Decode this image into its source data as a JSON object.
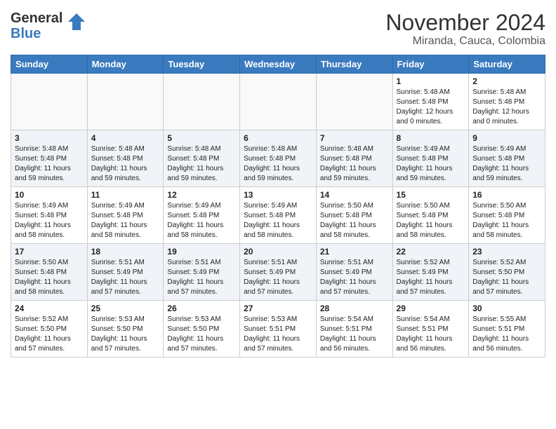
{
  "logo": {
    "part1": "General",
    "part2": "Blue"
  },
  "title": "November 2024",
  "subtitle": "Miranda, Cauca, Colombia",
  "weekdays": [
    "Sunday",
    "Monday",
    "Tuesday",
    "Wednesday",
    "Thursday",
    "Friday",
    "Saturday"
  ],
  "weeks": [
    {
      "alt": false,
      "days": [
        {
          "num": "",
          "sunrise": "",
          "sunset": "",
          "daylight": "",
          "empty": true
        },
        {
          "num": "",
          "sunrise": "",
          "sunset": "",
          "daylight": "",
          "empty": true
        },
        {
          "num": "",
          "sunrise": "",
          "sunset": "",
          "daylight": "",
          "empty": true
        },
        {
          "num": "",
          "sunrise": "",
          "sunset": "",
          "daylight": "",
          "empty": true
        },
        {
          "num": "",
          "sunrise": "",
          "sunset": "",
          "daylight": "",
          "empty": true
        },
        {
          "num": "1",
          "sunrise": "Sunrise: 5:48 AM",
          "sunset": "Sunset: 5:48 PM",
          "daylight": "Daylight: 12 hours and 0 minutes.",
          "empty": false
        },
        {
          "num": "2",
          "sunrise": "Sunrise: 5:48 AM",
          "sunset": "Sunset: 5:48 PM",
          "daylight": "Daylight: 12 hours and 0 minutes.",
          "empty": false
        }
      ]
    },
    {
      "alt": true,
      "days": [
        {
          "num": "3",
          "sunrise": "Sunrise: 5:48 AM",
          "sunset": "Sunset: 5:48 PM",
          "daylight": "Daylight: 11 hours and 59 minutes.",
          "empty": false
        },
        {
          "num": "4",
          "sunrise": "Sunrise: 5:48 AM",
          "sunset": "Sunset: 5:48 PM",
          "daylight": "Daylight: 11 hours and 59 minutes.",
          "empty": false
        },
        {
          "num": "5",
          "sunrise": "Sunrise: 5:48 AM",
          "sunset": "Sunset: 5:48 PM",
          "daylight": "Daylight: 11 hours and 59 minutes.",
          "empty": false
        },
        {
          "num": "6",
          "sunrise": "Sunrise: 5:48 AM",
          "sunset": "Sunset: 5:48 PM",
          "daylight": "Daylight: 11 hours and 59 minutes.",
          "empty": false
        },
        {
          "num": "7",
          "sunrise": "Sunrise: 5:48 AM",
          "sunset": "Sunset: 5:48 PM",
          "daylight": "Daylight: 11 hours and 59 minutes.",
          "empty": false
        },
        {
          "num": "8",
          "sunrise": "Sunrise: 5:49 AM",
          "sunset": "Sunset: 5:48 PM",
          "daylight": "Daylight: 11 hours and 59 minutes.",
          "empty": false
        },
        {
          "num": "9",
          "sunrise": "Sunrise: 5:49 AM",
          "sunset": "Sunset: 5:48 PM",
          "daylight": "Daylight: 11 hours and 59 minutes.",
          "empty": false
        }
      ]
    },
    {
      "alt": false,
      "days": [
        {
          "num": "10",
          "sunrise": "Sunrise: 5:49 AM",
          "sunset": "Sunset: 5:48 PM",
          "daylight": "Daylight: 11 hours and 58 minutes.",
          "empty": false
        },
        {
          "num": "11",
          "sunrise": "Sunrise: 5:49 AM",
          "sunset": "Sunset: 5:48 PM",
          "daylight": "Daylight: 11 hours and 58 minutes.",
          "empty": false
        },
        {
          "num": "12",
          "sunrise": "Sunrise: 5:49 AM",
          "sunset": "Sunset: 5:48 PM",
          "daylight": "Daylight: 11 hours and 58 minutes.",
          "empty": false
        },
        {
          "num": "13",
          "sunrise": "Sunrise: 5:49 AM",
          "sunset": "Sunset: 5:48 PM",
          "daylight": "Daylight: 11 hours and 58 minutes.",
          "empty": false
        },
        {
          "num": "14",
          "sunrise": "Sunrise: 5:50 AM",
          "sunset": "Sunset: 5:48 PM",
          "daylight": "Daylight: 11 hours and 58 minutes.",
          "empty": false
        },
        {
          "num": "15",
          "sunrise": "Sunrise: 5:50 AM",
          "sunset": "Sunset: 5:48 PM",
          "daylight": "Daylight: 11 hours and 58 minutes.",
          "empty": false
        },
        {
          "num": "16",
          "sunrise": "Sunrise: 5:50 AM",
          "sunset": "Sunset: 5:48 PM",
          "daylight": "Daylight: 11 hours and 58 minutes.",
          "empty": false
        }
      ]
    },
    {
      "alt": true,
      "days": [
        {
          "num": "17",
          "sunrise": "Sunrise: 5:50 AM",
          "sunset": "Sunset: 5:48 PM",
          "daylight": "Daylight: 11 hours and 58 minutes.",
          "empty": false
        },
        {
          "num": "18",
          "sunrise": "Sunrise: 5:51 AM",
          "sunset": "Sunset: 5:49 PM",
          "daylight": "Daylight: 11 hours and 57 minutes.",
          "empty": false
        },
        {
          "num": "19",
          "sunrise": "Sunrise: 5:51 AM",
          "sunset": "Sunset: 5:49 PM",
          "daylight": "Daylight: 11 hours and 57 minutes.",
          "empty": false
        },
        {
          "num": "20",
          "sunrise": "Sunrise: 5:51 AM",
          "sunset": "Sunset: 5:49 PM",
          "daylight": "Daylight: 11 hours and 57 minutes.",
          "empty": false
        },
        {
          "num": "21",
          "sunrise": "Sunrise: 5:51 AM",
          "sunset": "Sunset: 5:49 PM",
          "daylight": "Daylight: 11 hours and 57 minutes.",
          "empty": false
        },
        {
          "num": "22",
          "sunrise": "Sunrise: 5:52 AM",
          "sunset": "Sunset: 5:49 PM",
          "daylight": "Daylight: 11 hours and 57 minutes.",
          "empty": false
        },
        {
          "num": "23",
          "sunrise": "Sunrise: 5:52 AM",
          "sunset": "Sunset: 5:50 PM",
          "daylight": "Daylight: 11 hours and 57 minutes.",
          "empty": false
        }
      ]
    },
    {
      "alt": false,
      "days": [
        {
          "num": "24",
          "sunrise": "Sunrise: 5:52 AM",
          "sunset": "Sunset: 5:50 PM",
          "daylight": "Daylight: 11 hours and 57 minutes.",
          "empty": false
        },
        {
          "num": "25",
          "sunrise": "Sunrise: 5:53 AM",
          "sunset": "Sunset: 5:50 PM",
          "daylight": "Daylight: 11 hours and 57 minutes.",
          "empty": false
        },
        {
          "num": "26",
          "sunrise": "Sunrise: 5:53 AM",
          "sunset": "Sunset: 5:50 PM",
          "daylight": "Daylight: 11 hours and 57 minutes.",
          "empty": false
        },
        {
          "num": "27",
          "sunrise": "Sunrise: 5:53 AM",
          "sunset": "Sunset: 5:51 PM",
          "daylight": "Daylight: 11 hours and 57 minutes.",
          "empty": false
        },
        {
          "num": "28",
          "sunrise": "Sunrise: 5:54 AM",
          "sunset": "Sunset: 5:51 PM",
          "daylight": "Daylight: 11 hours and 56 minutes.",
          "empty": false
        },
        {
          "num": "29",
          "sunrise": "Sunrise: 5:54 AM",
          "sunset": "Sunset: 5:51 PM",
          "daylight": "Daylight: 11 hours and 56 minutes.",
          "empty": false
        },
        {
          "num": "30",
          "sunrise": "Sunrise: 5:55 AM",
          "sunset": "Sunset: 5:51 PM",
          "daylight": "Daylight: 11 hours and 56 minutes.",
          "empty": false
        }
      ]
    }
  ]
}
